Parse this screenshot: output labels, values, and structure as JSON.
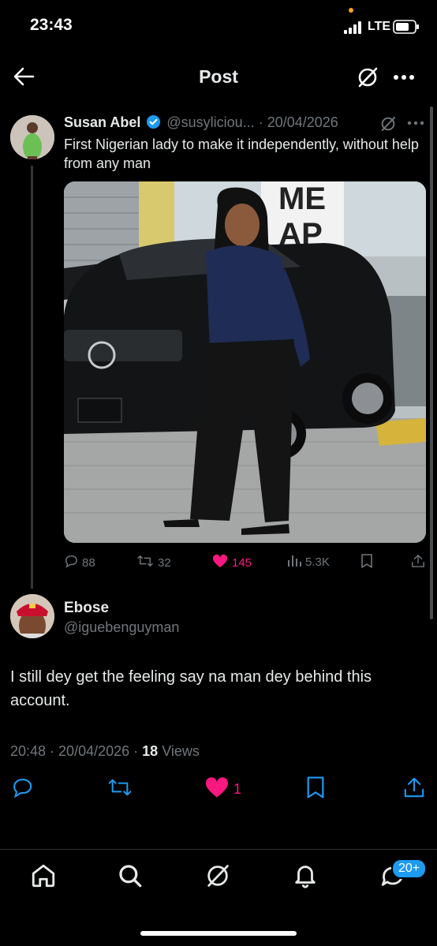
{
  "status_bar": {
    "time": "23:43",
    "network": "LTE"
  },
  "header": {
    "title": "Post"
  },
  "quoted_post": {
    "author_name": "Susan Abel",
    "handle": "@susyliciou...",
    "separator": " · ",
    "date": "20/04/2026",
    "text": "First Nigerian lady to make it independently, without help from any man",
    "photo_sign_text": [
      "ME",
      "AP"
    ],
    "stats": {
      "replies": "88",
      "reposts": "32",
      "likes": "145",
      "views": "5.3K"
    }
  },
  "reply": {
    "author_name": "Ebose",
    "handle": "@iguebenguyman",
    "text": "I still dey get the feeling say na man dey behind this account.",
    "time": "20:48",
    "date": "20/04/2026",
    "views_count": "18",
    "views_label": "Views",
    "like_count": "1"
  },
  "bottom_nav": {
    "notifications_badge": "20+"
  },
  "colors": {
    "background": "#000000",
    "text": "#e7e9ea",
    "muted": "#71767b",
    "like": "#f91880",
    "verified": "#1d9bf0"
  }
}
